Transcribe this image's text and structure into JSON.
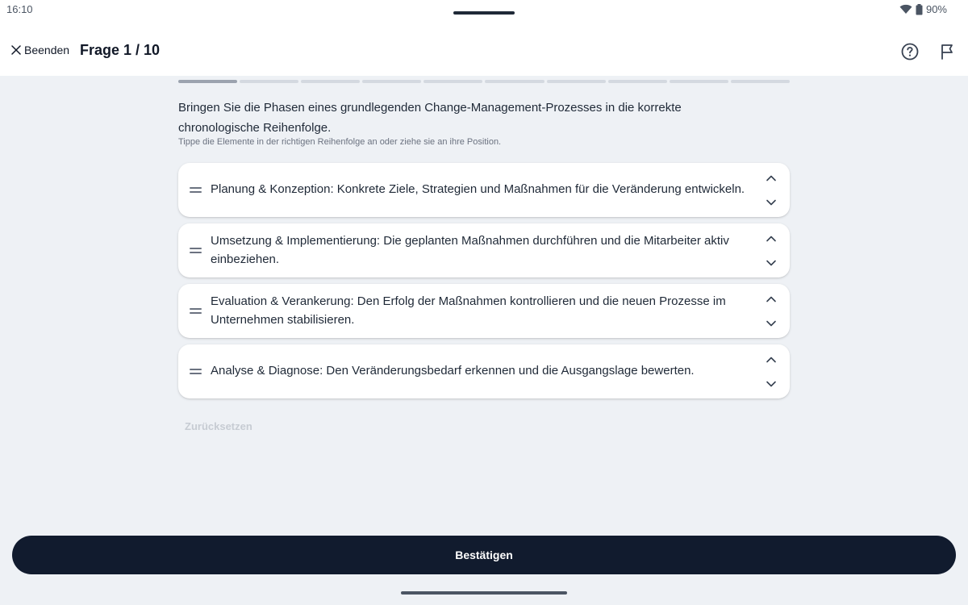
{
  "status": {
    "time": "16:10",
    "battery": "90%",
    "icons": [
      "wifi-icon",
      "battery-icon"
    ]
  },
  "header": {
    "close_label": "Beenden",
    "title": "Frage 1 / 10",
    "icons": [
      "close-icon",
      "help-icon",
      "flag-icon"
    ]
  },
  "progress": {
    "current": 1,
    "total": 10
  },
  "question": {
    "text": "Bringen Sie die Phasen eines grundlegenden Change-Management-Prozesses in die korrekte chronologische Reihenfolge.",
    "hint": "Tippe die Elemente in der richtigen Reihenfolge an oder ziehe sie an ihre Position."
  },
  "items": [
    {
      "text": "Planung & Konzeption: Konkrete Ziele, Strategien und Maßnahmen für die Veränderung entwickeln."
    },
    {
      "text": "Umsetzung & Implementierung: Die geplanten Maßnahmen durchführen und die Mitarbeiter aktiv einbeziehen."
    },
    {
      "text": "Evaluation & Verankerung: Den Erfolg der Maßnahmen kontrollieren und die neuen Prozesse im Unternehmen stabilisieren."
    },
    {
      "text": "Analyse & Diagnose: Den Veränderungsbedarf erkennen und die Ausgangslage bewerten."
    }
  ],
  "actions": {
    "reset_label": "Zurücksetzen",
    "confirm_label": "Bestätigen"
  },
  "colors": {
    "background": "#eef1f5",
    "button": "#111b2e",
    "progress_active": "#9ca3af",
    "progress_inactive": "#d4d9e0"
  }
}
